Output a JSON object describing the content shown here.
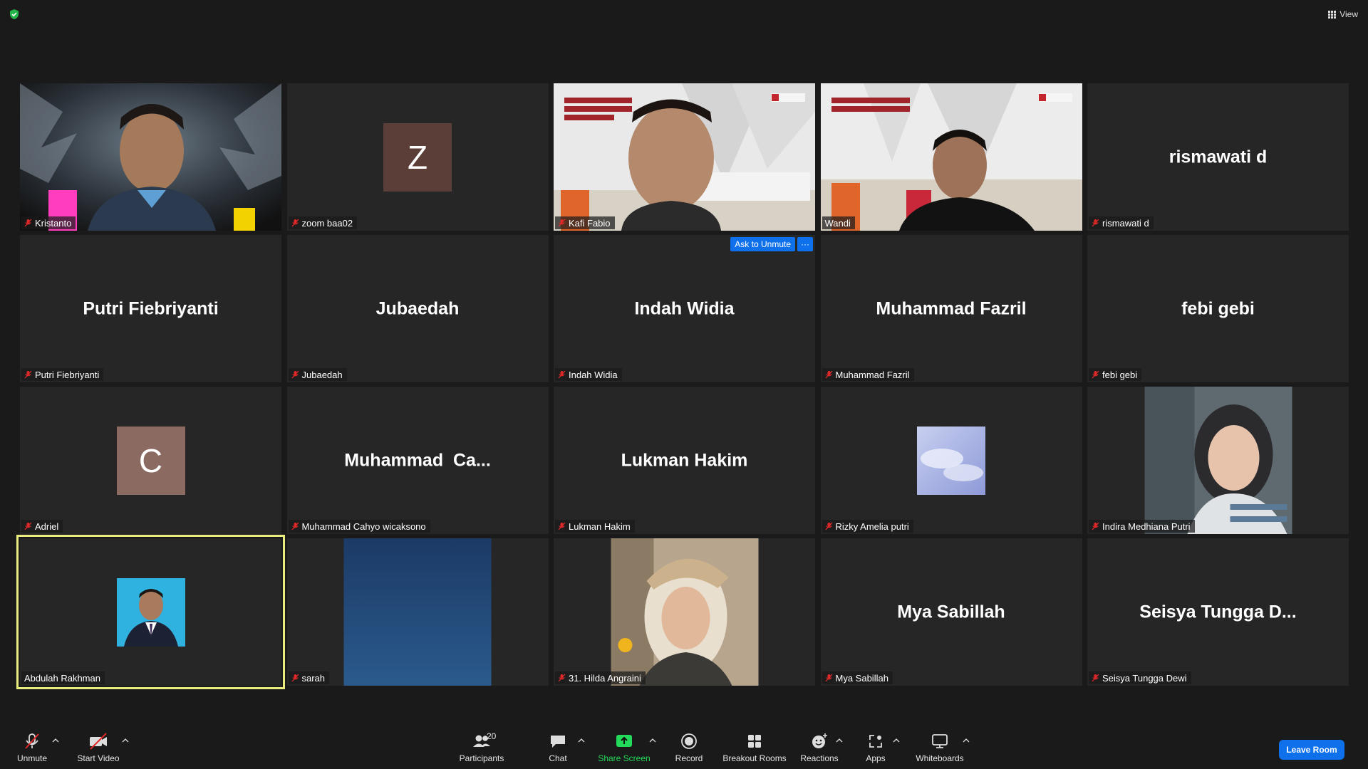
{
  "top": {
    "view_label": "View"
  },
  "tiles": [
    {
      "type": "video",
      "name": "Kristanto",
      "muted": true
    },
    {
      "type": "letter",
      "letter": "Z",
      "name": "zoom baa02",
      "muted": true,
      "bg": "#5b3e38"
    },
    {
      "type": "video",
      "name": "Kafi Fabio",
      "muted": true
    },
    {
      "type": "video",
      "name": "Wandi",
      "muted": false
    },
    {
      "type": "text",
      "display": "rismawati d",
      "name": "rismawati d",
      "muted": true
    },
    {
      "type": "text",
      "display": "Putri Fiebriyanti",
      "name": "Putri Fiebriyanti",
      "muted": true
    },
    {
      "type": "text",
      "display": "Jubaedah",
      "name": "Jubaedah",
      "muted": true
    },
    {
      "type": "text",
      "display": "Indah Widia",
      "name": "Indah Widia",
      "muted": true,
      "ask_unmute": true
    },
    {
      "type": "text",
      "display": "Muhammad Fazril",
      "name": "Muhammad Fazril",
      "muted": true
    },
    {
      "type": "text",
      "display": "febi gebi",
      "name": "febi gebi",
      "muted": true
    },
    {
      "type": "letter",
      "letter": "C",
      "name": "Adriel",
      "muted": true,
      "bg": "#8b6a62"
    },
    {
      "type": "text",
      "display": "Muhammad  Ca...",
      "name": "Muhammad Cahyo wicaksono",
      "muted": true
    },
    {
      "type": "text",
      "display": "Lukman Hakim",
      "name": "Lukman Hakim",
      "muted": true
    },
    {
      "type": "image",
      "name": "Rizky Amelia putri",
      "muted": true
    },
    {
      "type": "portrait",
      "name": "Indira Medhiana Putri",
      "muted": true
    },
    {
      "type": "image",
      "name": "Abdulah Rakhman",
      "muted": false,
      "active": true
    },
    {
      "type": "portrait",
      "name": "sarah",
      "muted": true
    },
    {
      "type": "portrait",
      "name": "31. Hilda Angraini",
      "muted": true
    },
    {
      "type": "text",
      "display": "Mya Sabillah",
      "name": "Mya Sabillah",
      "muted": true
    },
    {
      "type": "text",
      "display": "Seisya Tungga D...",
      "name": "Seisya Tungga Dewi",
      "muted": true
    }
  ],
  "ask_unmute": {
    "label": "Ask to Unmute",
    "more": "···"
  },
  "toolbar": {
    "unmute": "Unmute",
    "start_video": "Start Video",
    "participants": "Participants",
    "participants_count": "20",
    "chat": "Chat",
    "share_screen": "Share Screen",
    "record": "Record",
    "breakout_rooms": "Breakout Rooms",
    "reactions": "Reactions",
    "apps": "Apps",
    "whiteboards": "Whiteboards",
    "leave_room": "Leave Room"
  },
  "colors": {
    "accent": "#0e71eb",
    "share_green": "#23d959",
    "active_outline": "#e9ec7f",
    "mute_red": "#e02828"
  }
}
